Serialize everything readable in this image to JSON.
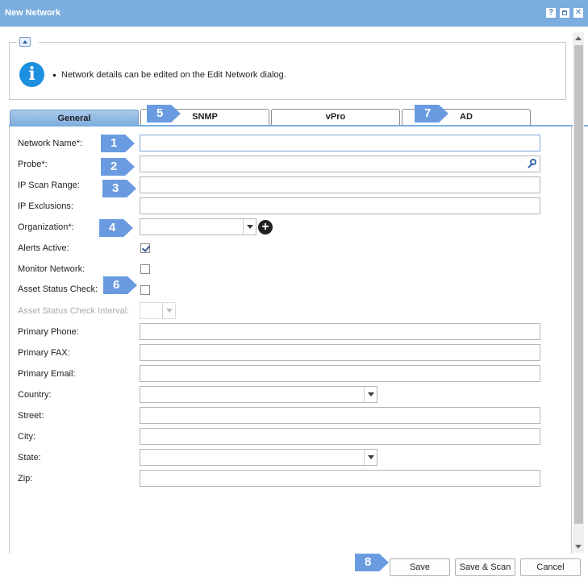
{
  "window": {
    "title": "New Network",
    "help_label": "?",
    "close_label": "✕"
  },
  "info": {
    "message": "Network details can be edited on the Edit Network dialog."
  },
  "tabs": [
    {
      "label": "General"
    },
    {
      "label": "SNMP"
    },
    {
      "label": "vPro"
    },
    {
      "label": "AD"
    }
  ],
  "form": {
    "network_name": {
      "label": "Network Name*:",
      "value": ""
    },
    "probe": {
      "label": "Probe*:",
      "value": ""
    },
    "ip_scan_range": {
      "label": "IP Scan Range:",
      "value": ""
    },
    "ip_exclusions": {
      "label": "IP Exclusions:",
      "value": ""
    },
    "organization": {
      "label": "Organization*:",
      "value": ""
    },
    "alerts_active": {
      "label": "Alerts Active:",
      "checked": true
    },
    "monitor_network": {
      "label": "Monitor Network:",
      "checked": false
    },
    "asset_status_check": {
      "label": "Asset Status Check:",
      "checked": false
    },
    "asset_status_check_interval": {
      "label": "Asset Status Check Interval:",
      "value": ""
    },
    "primary_phone": {
      "label": "Primary Phone:",
      "value": ""
    },
    "primary_fax": {
      "label": "Primary FAX:",
      "value": ""
    },
    "primary_email": {
      "label": "Primary Email:",
      "value": ""
    },
    "country": {
      "label": "Country:",
      "value": ""
    },
    "street": {
      "label": "Street:",
      "value": ""
    },
    "city": {
      "label": "City:",
      "value": ""
    },
    "state": {
      "label": "State:",
      "value": ""
    },
    "zip": {
      "label": "Zip:",
      "value": ""
    }
  },
  "organization_add_label": "+",
  "markers": [
    "1",
    "2",
    "3",
    "4",
    "5",
    "6",
    "7",
    "8"
  ],
  "buttons": {
    "save": "Save",
    "save_scan": "Save & Scan",
    "cancel": "Cancel"
  },
  "colors": {
    "titlebar": "#7badde",
    "marker": "#6a9be0",
    "info_icon": "#1e90e0"
  }
}
